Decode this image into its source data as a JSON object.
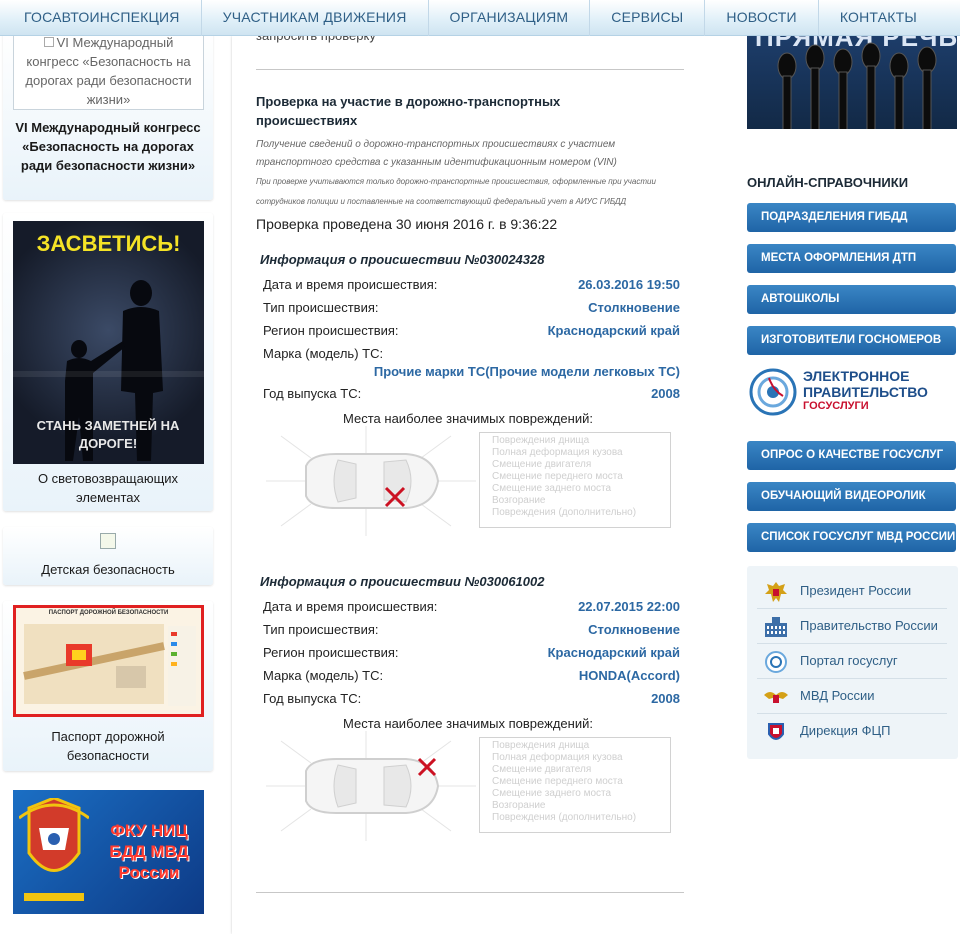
{
  "nav": [
    "ГОСАВТОИНСПЕКЦИЯ",
    "УЧАСТНИКАМ ДВИЖЕНИЯ",
    "ОРГАНИЗАЦИЯМ",
    "СЕРВИСЫ",
    "НОВОСТИ",
    "КОНТАКТЫ"
  ],
  "left": {
    "congress_alt": "VI Международный конгресс «Безопасность на дорогах ради безопасности жизни»",
    "congress_caption": "VI Международный конгресс «Безопасность на дорогах ради безопасности жизни»",
    "poster_top": "ЗАСВЕТИСЬ!",
    "poster_bottom": "СТАНЬ ЗАМЕТНЕЙ НА ДОРОГЕ!",
    "reflect_caption": "О световозвращающих элементах",
    "child_caption": "Детская безопасность",
    "passport_header": "ПАСПОРТ ДОРОЖНОЙ БЕЗОПАСНОСТИ",
    "passport_caption": "Паспорт дорожной безопасности",
    "fku_text": "ФКУ НИЦ БДД МВД России"
  },
  "center": {
    "request_link": "запросить проверку",
    "section_title": "Проверка на участие в дорожно-транспортных происшествиях",
    "note1": "Получение сведений о дорожно-транспортных происшествиях с участием транспортного средства с указанным идентификационным номером (VIN)",
    "note2": "При проверке учитываются только дорожно-транспортные происшествия, оформленные при участии сотрудников полиции и поставленные на соответствующий федеральный учет в АИУС ГИБДД",
    "checked": "Проверка проведена 30 июня 2016 г. в 9:36:22",
    "labels": {
      "datetime": "Дата и время происшествия:",
      "type": "Тип происшествия:",
      "region": "Регион происшествия:",
      "model": "Марка (модель) ТС:",
      "year": "Год выпуска ТС:",
      "damage": "Места наиболее значимых повреждений:"
    },
    "damage_list": [
      "Повреждения днища",
      "Полная деформация кузова",
      "Смещение двигателя",
      "Смещение переднего моста",
      "Смещение заднего моста",
      "Возгорание",
      "Повреждения (дополнительно)"
    ],
    "incidents": [
      {
        "title": "Информация о происшествии №030024328",
        "datetime": "26.03.2016 19:50",
        "type": "Столкновение",
        "region": "Краснодарский край",
        "model": "Прочие марки ТС(Прочие модели легковых ТС)",
        "year": "2008"
      },
      {
        "title": "Информация о происшествии №030061002",
        "datetime": "22.07.2015 22:00",
        "type": "Столкновение",
        "region": "Краснодарский край",
        "model": "HONDA(Accord)",
        "year": "2008"
      }
    ]
  },
  "right": {
    "banner_text": "ПРЯМАЯ РЕЧЬ",
    "heading": "ОНЛАЙН-СПРАВОЧНИКИ",
    "buttons_top": [
      "ПОДРАЗДЕЛЕНИЯ ГИБДД",
      "МЕСТА ОФОРМЛЕНИЯ ДТП",
      "АВТОШКОЛЫ",
      "ИЗГОТОВИТЕЛИ ГОСНОМЕРОВ"
    ],
    "egov_line1": "ЭЛЕКТРОННОЕ",
    "egov_line2": "ПРАВИТЕЛЬСТВО",
    "egov_line3": "ГОСУСЛУГИ",
    "buttons_bottom": [
      "ОПРОС О КАЧЕСТВЕ ГОСУСЛУГ",
      "ОБУЧАЮЩИЙ ВИДЕОРОЛИК",
      "СПИСОК ГОСУСЛУГ МВД РОССИИ"
    ],
    "links": [
      "Президент России",
      "Правительство России",
      "Портал госуслуг",
      "МВД России",
      "Дирекция ФЦП"
    ]
  },
  "colors": {
    "accent": "#2c68a3",
    "button": "#2a74b6",
    "nav_text": "#2f5f86",
    "damage_mark": "#cc1122"
  }
}
